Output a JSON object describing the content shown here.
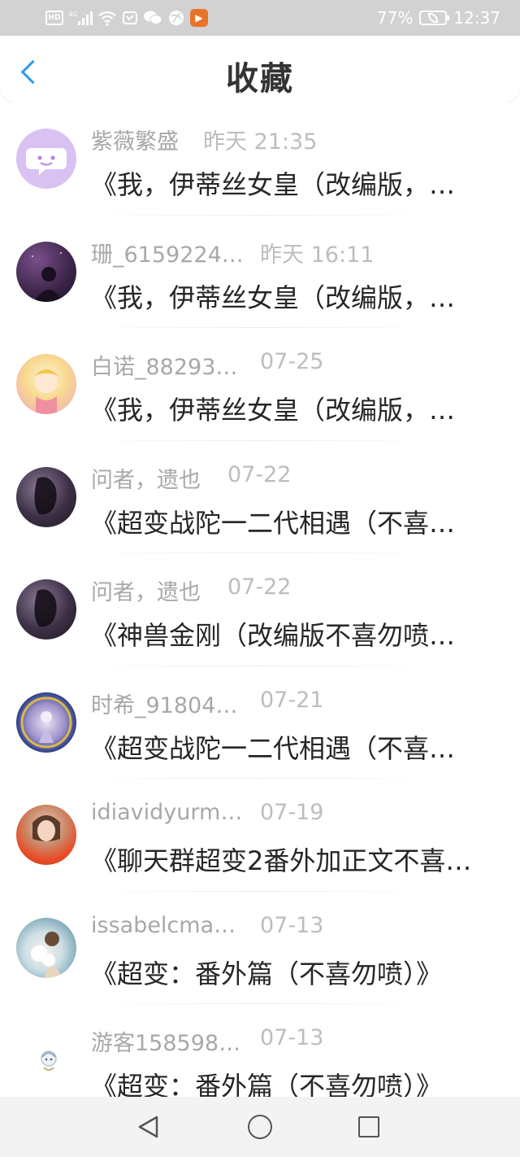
{
  "status_bar": {
    "hd_label": "HD",
    "signal_label": "4G",
    "battery_text": "77%",
    "time": "12:37"
  },
  "header": {
    "title": "收藏"
  },
  "favorites": [
    {
      "author": "紫薇繁盛",
      "time": "昨天 21:35",
      "title": "《我，伊蒂丝女皇（改编版，…"
    },
    {
      "author": "珊_6159224…",
      "time": "昨天 16:11",
      "title": "《我，伊蒂丝女皇（改编版，…"
    },
    {
      "author": "白诺_88293…",
      "time": "07-25",
      "title": "《我，伊蒂丝女皇（改编版，…"
    },
    {
      "author": "问者，遗也",
      "time": "07-22",
      "title": "《超变战陀一二代相遇（不喜…"
    },
    {
      "author": "问者，遗也",
      "time": "07-22",
      "title": "《神兽金刚（改编版不喜勿喷…"
    },
    {
      "author": "时希_91804…",
      "time": "07-21",
      "title": "《超变战陀一二代相遇（不喜…"
    },
    {
      "author": "idiavidyurm…",
      "time": "07-19",
      "title": "《聊天群超变2番外加正文不喜…"
    },
    {
      "author": "issabelcma…",
      "time": "07-13",
      "title": "《超变：番外篇（不喜勿喷）》"
    },
    {
      "author": "游客158598…",
      "time": "07-13",
      "title": "《超变：番外篇（不喜勿喷）》"
    }
  ],
  "colors": {
    "accent": "#2e9bf0",
    "status_bar": "#d2d2d2",
    "secondary_text": "#a8a8a8"
  }
}
